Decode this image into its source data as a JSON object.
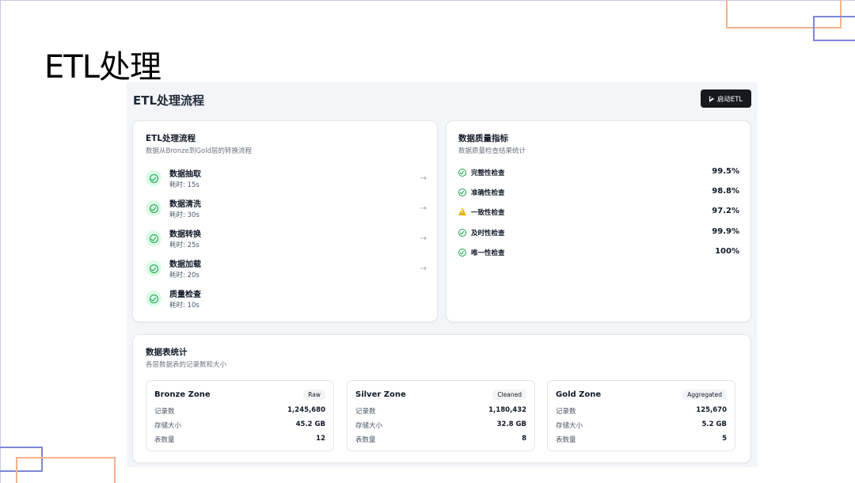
{
  "slide": {
    "title": "ETL处理"
  },
  "app": {
    "title": "ETL处理流程",
    "start_button": "启动ETL"
  },
  "flow": {
    "title": "ETL处理流程",
    "subtitle": "数据从Bronze到Gold层的转换流程",
    "steps": [
      {
        "name": "数据抽取",
        "time": "耗时: 15s",
        "has_arrow": true
      },
      {
        "name": "数据清洗",
        "time": "耗时: 30s",
        "has_arrow": true
      },
      {
        "name": "数据转换",
        "time": "耗时: 25s",
        "has_arrow": true
      },
      {
        "name": "数据加载",
        "time": "耗时: 20s",
        "has_arrow": true
      },
      {
        "name": "质量检查",
        "time": "耗时: 10s",
        "has_arrow": false
      }
    ]
  },
  "quality": {
    "title": "数据质量指标",
    "subtitle": "数据质量检查结果统计",
    "items": [
      {
        "label": "完整性检查",
        "value": "99.5%",
        "status": "ok"
      },
      {
        "label": "准确性检查",
        "value": "98.8%",
        "status": "ok"
      },
      {
        "label": "一致性检查",
        "value": "97.2%",
        "status": "warning"
      },
      {
        "label": "及时性检查",
        "value": "99.9%",
        "status": "ok"
      },
      {
        "label": "唯一性检查",
        "value": "100%",
        "status": "ok"
      }
    ]
  },
  "stats": {
    "title": "数据表统计",
    "subtitle": "各层数据表的记录数和大小",
    "zones": [
      {
        "name": "Bronze Zone",
        "badge": "Raw",
        "records_label": "记录数",
        "records": "1,245,680",
        "size_label": "存储大小",
        "size": "45.2 GB",
        "tables_label": "表数量",
        "tables": "12"
      },
      {
        "name": "Silver Zone",
        "badge": "Cleaned",
        "records_label": "记录数",
        "records": "1,180,432",
        "size_label": "存储大小",
        "size": "32.8 GB",
        "tables_label": "表数量",
        "tables": "8"
      },
      {
        "name": "Gold Zone",
        "badge": "Aggregated",
        "records_label": "记录数",
        "records": "125,670",
        "size_label": "存储大小",
        "size": "5.2 GB",
        "tables_label": "表数量",
        "tables": "5"
      }
    ]
  },
  "icons": {
    "step": "check-circle-icon",
    "arrow": "arrow-right-icon",
    "ok": "check-circle-icon",
    "warning": "warning-triangle-icon",
    "play": "play-icon"
  },
  "colors": {
    "success": "#16a34a",
    "success_bg": "#dcfce7",
    "warning": "#eab308",
    "button_bg": "#17191f",
    "accent_orange": "#f4b28e",
    "accent_blue": "#7d86d8"
  }
}
